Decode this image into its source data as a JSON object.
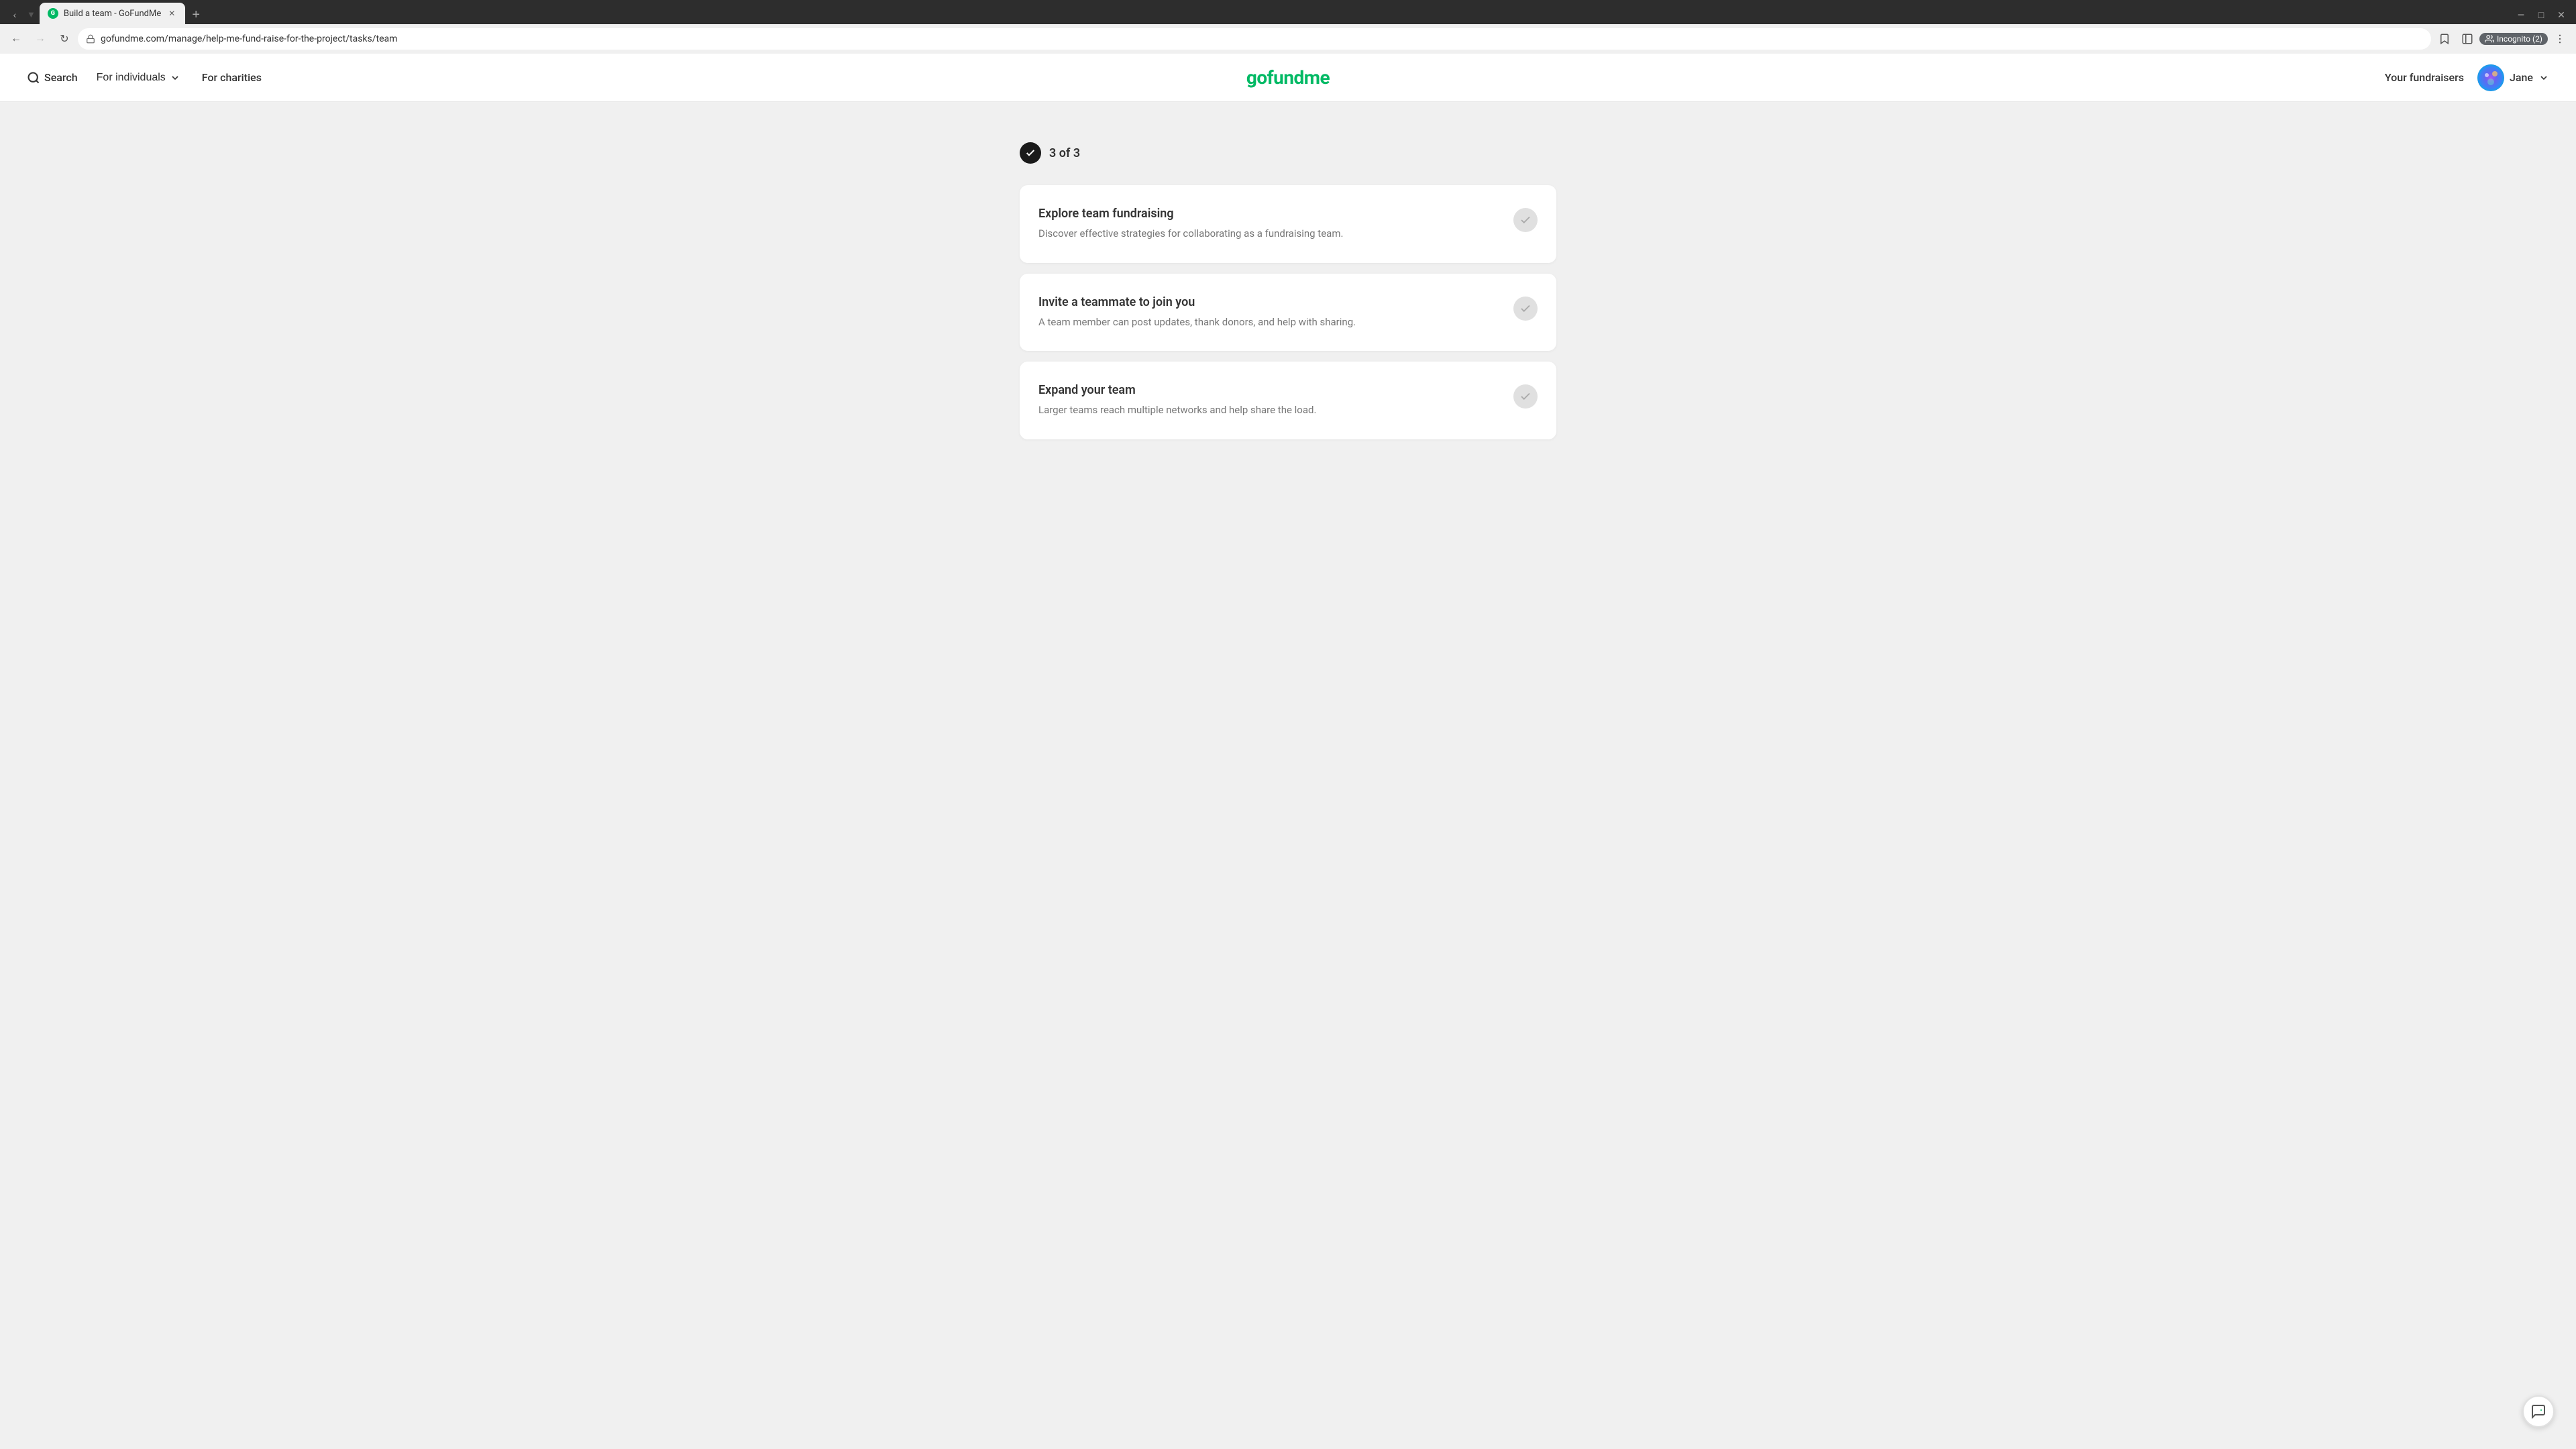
{
  "browser": {
    "tab_label": "Build a team - GoFundMe",
    "tab_favicon": "G",
    "url": "gofundme.com/manage/help-me-fund-raise-for-the-project/tasks/team",
    "incognito_label": "Incognito (2)"
  },
  "nav": {
    "search_label": "Search",
    "for_individuals_label": "For individuals",
    "for_charities_label": "For charities",
    "logo_text": "gofundme",
    "your_fundraisers_label": "Your fundraisers",
    "user_name": "Jane"
  },
  "main": {
    "progress_label": "3 of 3",
    "tasks": [
      {
        "title": "Explore team fundraising",
        "description": "Discover effective strategies for collaborating as a fundraising team."
      },
      {
        "title": "Invite a teammate to join you",
        "description": "A team member can post updates, thank donors, and help with sharing."
      },
      {
        "title": "Expand your team",
        "description": "Larger teams reach multiple networks and help share the load."
      }
    ]
  }
}
